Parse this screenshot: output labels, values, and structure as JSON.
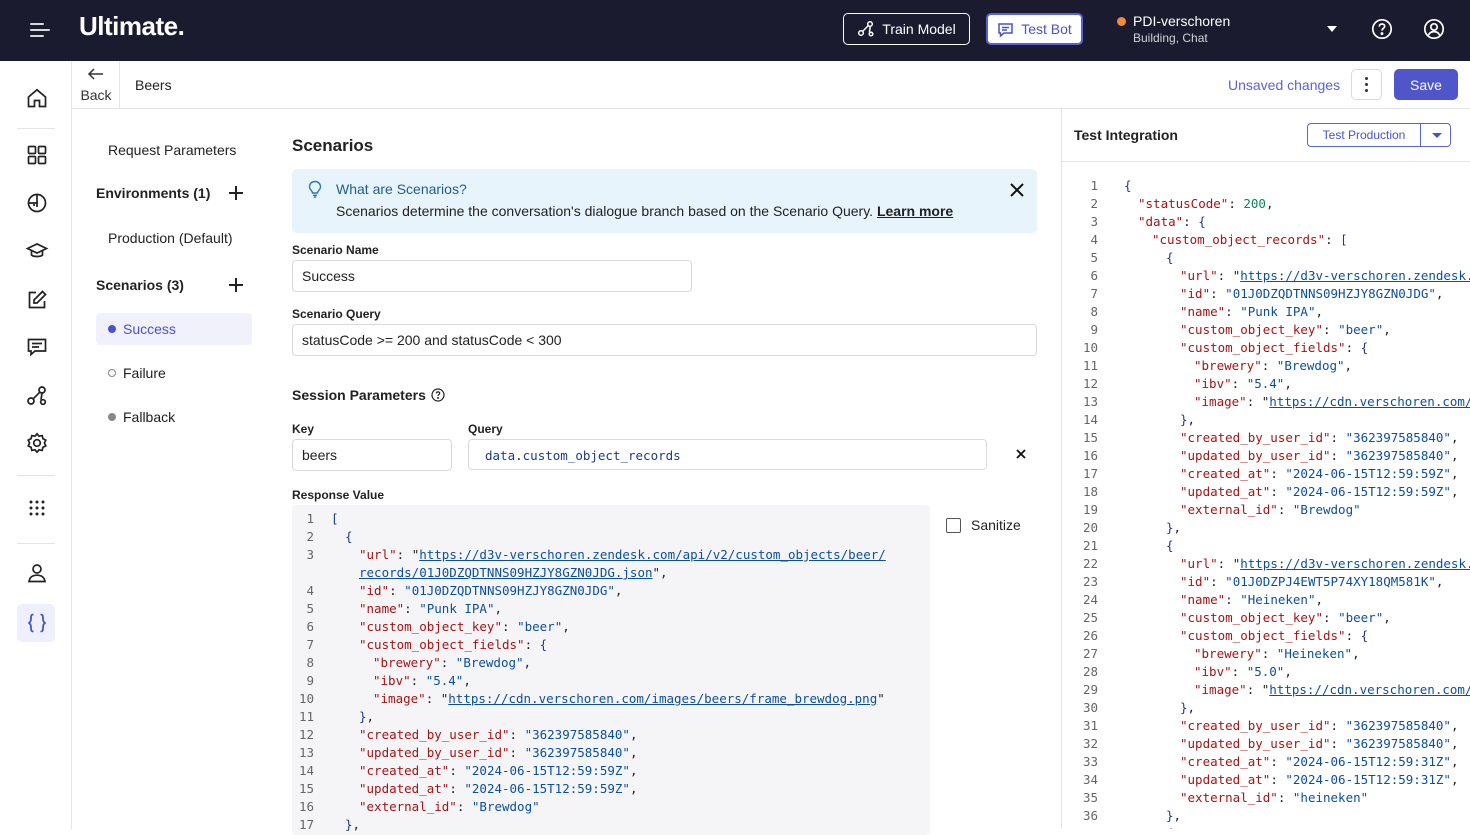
{
  "app": {
    "logo": "Ultimate.",
    "train_model_label": "Train Model",
    "test_bot_label": "Test Bot",
    "bot_name": "PDI-verschoren",
    "bot_subtitle": "Building, Chat",
    "bot_status_color": "#f08a3c",
    "accent_color": "#4f56c9"
  },
  "subheader": {
    "back_label": "Back",
    "breadcrumb": "Beers",
    "unsaved_label": "Unsaved changes",
    "save_label": "Save"
  },
  "sidebar": {
    "request_parameters": "Request Parameters",
    "environments_header": "Environments (1)",
    "environment_item": "Production (Default)",
    "scenarios_header": "Scenarios (3)",
    "scenarios": [
      {
        "label": "Success",
        "state": "active"
      },
      {
        "label": "Failure",
        "state": "empty"
      },
      {
        "label": "Fallback",
        "state": "filled"
      }
    ]
  },
  "main": {
    "title": "Scenarios",
    "info_title": "What are Scenarios?",
    "info_text": "Scenarios determine the conversation's dialogue branch based on the Scenario Query.",
    "info_link": "Learn more",
    "scenario_name_label": "Scenario Name",
    "scenario_name_value": "Success",
    "scenario_query_label": "Scenario Query",
    "scenario_query_value": "statusCode >= 200 and statusCode < 300",
    "session_parameters_label": "Session Parameters",
    "key_label": "Key",
    "key_value": "beers",
    "query_label": "Query",
    "query_prefix": "data",
    "query_dot": ".",
    "query_suffix": "custom_object_records",
    "response_value_label": "Response Value",
    "sanitize_label": "Sanitize",
    "sanitize_checked": false
  },
  "response_lines": [
    {
      "n": "1",
      "indent": 0,
      "parts": [
        [
          "b",
          "["
        ]
      ]
    },
    {
      "n": "2",
      "indent": 1,
      "parts": [
        [
          "b",
          "{"
        ]
      ]
    },
    {
      "n": "3",
      "indent": 2,
      "parts": [
        [
          "k",
          "\"url\""
        ],
        [
          "p",
          ": \""
        ],
        [
          "l",
          "https://d3v-verschoren.zendesk.com/api/v2/custom_objects/beer/"
        ]
      ]
    },
    {
      "n": "",
      "indent": 2,
      "parts": [
        [
          "l",
          "records/01J0DZQDTNNS09HZJY8GZN0JDG.json"
        ],
        [
          "p",
          "\","
        ]
      ]
    },
    {
      "n": "4",
      "indent": 2,
      "parts": [
        [
          "k",
          "\"id\""
        ],
        [
          "p",
          ": "
        ],
        [
          "v",
          "\"01J0DZQDTNNS09HZJY8GZN0JDG\""
        ],
        [
          "p",
          ","
        ]
      ]
    },
    {
      "n": "5",
      "indent": 2,
      "parts": [
        [
          "k",
          "\"name\""
        ],
        [
          "p",
          ": "
        ],
        [
          "v",
          "\"Punk IPA\""
        ],
        [
          "p",
          ","
        ]
      ]
    },
    {
      "n": "6",
      "indent": 2,
      "parts": [
        [
          "k",
          "\"custom_object_key\""
        ],
        [
          "p",
          ": "
        ],
        [
          "v",
          "\"beer\""
        ],
        [
          "p",
          ","
        ]
      ]
    },
    {
      "n": "7",
      "indent": 2,
      "parts": [
        [
          "k",
          "\"custom_object_fields\""
        ],
        [
          "p",
          ": "
        ],
        [
          "b",
          "{"
        ]
      ]
    },
    {
      "n": "8",
      "indent": 3,
      "parts": [
        [
          "k",
          "\"brewery\""
        ],
        [
          "p",
          ": "
        ],
        [
          "v",
          "\"Brewdog\""
        ],
        [
          "p",
          ","
        ]
      ]
    },
    {
      "n": "9",
      "indent": 3,
      "parts": [
        [
          "k",
          "\"ibv\""
        ],
        [
          "p",
          ": "
        ],
        [
          "v",
          "\"5.4\""
        ],
        [
          "p",
          ","
        ]
      ]
    },
    {
      "n": "10",
      "indent": 3,
      "parts": [
        [
          "k",
          "\"image\""
        ],
        [
          "p",
          ": \""
        ],
        [
          "l",
          "https://cdn.verschoren.com/images/beers/frame_brewdog.png"
        ],
        [
          "p",
          "\""
        ]
      ]
    },
    {
      "n": "11",
      "indent": 2,
      "parts": [
        [
          "b",
          "}"
        ],
        [
          "p",
          ","
        ]
      ]
    },
    {
      "n": "12",
      "indent": 2,
      "parts": [
        [
          "k",
          "\"created_by_user_id\""
        ],
        [
          "p",
          ": "
        ],
        [
          "v",
          "\"362397585840\""
        ],
        [
          "p",
          ","
        ]
      ]
    },
    {
      "n": "13",
      "indent": 2,
      "parts": [
        [
          "k",
          "\"updated_by_user_id\""
        ],
        [
          "p",
          ": "
        ],
        [
          "v",
          "\"362397585840\""
        ],
        [
          "p",
          ","
        ]
      ]
    },
    {
      "n": "14",
      "indent": 2,
      "parts": [
        [
          "k",
          "\"created_at\""
        ],
        [
          "p",
          ": "
        ],
        [
          "v",
          "\"2024-06-15T12:59:59Z\""
        ],
        [
          "p",
          ","
        ]
      ]
    },
    {
      "n": "15",
      "indent": 2,
      "parts": [
        [
          "k",
          "\"updated_at\""
        ],
        [
          "p",
          ": "
        ],
        [
          "v",
          "\"2024-06-15T12:59:59Z\""
        ],
        [
          "p",
          ","
        ]
      ]
    },
    {
      "n": "16",
      "indent": 2,
      "parts": [
        [
          "k",
          "\"external_id\""
        ],
        [
          "p",
          ": "
        ],
        [
          "v",
          "\"Brewdog\""
        ]
      ]
    },
    {
      "n": "17",
      "indent": 1,
      "parts": [
        [
          "b",
          "}"
        ],
        [
          "p",
          ","
        ]
      ]
    }
  ],
  "test_panel": {
    "title": "Test Integration",
    "env_button": "Test Production"
  },
  "test_lines": [
    {
      "n": "1",
      "indent": 0,
      "parts": [
        [
          "b",
          "{"
        ]
      ]
    },
    {
      "n": "2",
      "indent": 1,
      "parts": [
        [
          "k",
          "\"statusCode\""
        ],
        [
          "p",
          ": "
        ],
        [
          "n",
          "200"
        ],
        [
          "p",
          ","
        ]
      ]
    },
    {
      "n": "3",
      "indent": 1,
      "parts": [
        [
          "k",
          "\"data\""
        ],
        [
          "p",
          ": "
        ],
        [
          "b",
          "{"
        ]
      ]
    },
    {
      "n": "4",
      "indent": 2,
      "parts": [
        [
          "k",
          "\"custom_object_records\""
        ],
        [
          "p",
          ": "
        ],
        [
          "b",
          "["
        ]
      ]
    },
    {
      "n": "5",
      "indent": 3,
      "parts": [
        [
          "b",
          "{"
        ]
      ]
    },
    {
      "n": "6",
      "indent": 4,
      "parts": [
        [
          "k",
          "\"url\""
        ],
        [
          "p",
          ": \""
        ],
        [
          "l",
          "https://d3v-verschoren.zendesk.c"
        ]
      ]
    },
    {
      "n": "7",
      "indent": 4,
      "parts": [
        [
          "k",
          "\"id\""
        ],
        [
          "p",
          ": "
        ],
        [
          "v",
          "\"01J0DZQDTNNS09HZJY8GZN0JDG\""
        ],
        [
          "p",
          ","
        ]
      ]
    },
    {
      "n": "8",
      "indent": 4,
      "parts": [
        [
          "k",
          "\"name\""
        ],
        [
          "p",
          ": "
        ],
        [
          "v",
          "\"Punk IPA\""
        ],
        [
          "p",
          ","
        ]
      ]
    },
    {
      "n": "9",
      "indent": 4,
      "parts": [
        [
          "k",
          "\"custom_object_key\""
        ],
        [
          "p",
          ": "
        ],
        [
          "v",
          "\"beer\""
        ],
        [
          "p",
          ","
        ]
      ]
    },
    {
      "n": "10",
      "indent": 4,
      "parts": [
        [
          "k",
          "\"custom_object_fields\""
        ],
        [
          "p",
          ": "
        ],
        [
          "b",
          "{"
        ]
      ]
    },
    {
      "n": "11",
      "indent": 5,
      "parts": [
        [
          "k",
          "\"brewery\""
        ],
        [
          "p",
          ": "
        ],
        [
          "v",
          "\"Brewdog\""
        ],
        [
          "p",
          ","
        ]
      ]
    },
    {
      "n": "12",
      "indent": 5,
      "parts": [
        [
          "k",
          "\"ibv\""
        ],
        [
          "p",
          ": "
        ],
        [
          "v",
          "\"5.4\""
        ],
        [
          "p",
          ","
        ]
      ]
    },
    {
      "n": "13",
      "indent": 5,
      "parts": [
        [
          "k",
          "\"image\""
        ],
        [
          "p",
          ": \""
        ],
        [
          "l",
          "https://cdn.verschoren.com/i"
        ]
      ]
    },
    {
      "n": "14",
      "indent": 4,
      "parts": [
        [
          "b",
          "}"
        ],
        [
          "p",
          ","
        ]
      ]
    },
    {
      "n": "15",
      "indent": 4,
      "parts": [
        [
          "k",
          "\"created_by_user_id\""
        ],
        [
          "p",
          ": "
        ],
        [
          "v",
          "\"362397585840\""
        ],
        [
          "p",
          ","
        ]
      ]
    },
    {
      "n": "16",
      "indent": 4,
      "parts": [
        [
          "k",
          "\"updated_by_user_id\""
        ],
        [
          "p",
          ": "
        ],
        [
          "v",
          "\"362397585840\""
        ],
        [
          "p",
          ","
        ]
      ]
    },
    {
      "n": "17",
      "indent": 4,
      "parts": [
        [
          "k",
          "\"created_at\""
        ],
        [
          "p",
          ": "
        ],
        [
          "v",
          "\"2024-06-15T12:59:59Z\""
        ],
        [
          "p",
          ","
        ]
      ]
    },
    {
      "n": "18",
      "indent": 4,
      "parts": [
        [
          "k",
          "\"updated_at\""
        ],
        [
          "p",
          ": "
        ],
        [
          "v",
          "\"2024-06-15T12:59:59Z\""
        ],
        [
          "p",
          ","
        ]
      ]
    },
    {
      "n": "19",
      "indent": 4,
      "parts": [
        [
          "k",
          "\"external_id\""
        ],
        [
          "p",
          ": "
        ],
        [
          "v",
          "\"Brewdog\""
        ]
      ]
    },
    {
      "n": "20",
      "indent": 3,
      "parts": [
        [
          "b",
          "}"
        ],
        [
          "p",
          ","
        ]
      ]
    },
    {
      "n": "21",
      "indent": 3,
      "parts": [
        [
          "b",
          "{"
        ]
      ]
    },
    {
      "n": "22",
      "indent": 4,
      "parts": [
        [
          "k",
          "\"url\""
        ],
        [
          "p",
          ": \""
        ],
        [
          "l",
          "https://d3v-verschoren.zendesk.c"
        ]
      ]
    },
    {
      "n": "23",
      "indent": 4,
      "parts": [
        [
          "k",
          "\"id\""
        ],
        [
          "p",
          ": "
        ],
        [
          "v",
          "\"01J0DZPJ4EWT5P74XY18QM581K\""
        ],
        [
          "p",
          ","
        ]
      ]
    },
    {
      "n": "24",
      "indent": 4,
      "parts": [
        [
          "k",
          "\"name\""
        ],
        [
          "p",
          ": "
        ],
        [
          "v",
          "\"Heineken\""
        ],
        [
          "p",
          ","
        ]
      ]
    },
    {
      "n": "25",
      "indent": 4,
      "parts": [
        [
          "k",
          "\"custom_object_key\""
        ],
        [
          "p",
          ": "
        ],
        [
          "v",
          "\"beer\""
        ],
        [
          "p",
          ","
        ]
      ]
    },
    {
      "n": "26",
      "indent": 4,
      "parts": [
        [
          "k",
          "\"custom_object_fields\""
        ],
        [
          "p",
          ": "
        ],
        [
          "b",
          "{"
        ]
      ]
    },
    {
      "n": "27",
      "indent": 5,
      "parts": [
        [
          "k",
          "\"brewery\""
        ],
        [
          "p",
          ": "
        ],
        [
          "v",
          "\"Heineken\""
        ],
        [
          "p",
          ","
        ]
      ]
    },
    {
      "n": "28",
      "indent": 5,
      "parts": [
        [
          "k",
          "\"ibv\""
        ],
        [
          "p",
          ": "
        ],
        [
          "v",
          "\"5.0\""
        ],
        [
          "p",
          ","
        ]
      ]
    },
    {
      "n": "29",
      "indent": 5,
      "parts": [
        [
          "k",
          "\"image\""
        ],
        [
          "p",
          ": \""
        ],
        [
          "l",
          "https://cdn.verschoren.com/i"
        ]
      ]
    },
    {
      "n": "30",
      "indent": 4,
      "parts": [
        [
          "b",
          "}"
        ],
        [
          "p",
          ","
        ]
      ]
    },
    {
      "n": "31",
      "indent": 4,
      "parts": [
        [
          "k",
          "\"created_by_user_id\""
        ],
        [
          "p",
          ": "
        ],
        [
          "v",
          "\"362397585840\""
        ],
        [
          "p",
          ","
        ]
      ]
    },
    {
      "n": "32",
      "indent": 4,
      "parts": [
        [
          "k",
          "\"updated_by_user_id\""
        ],
        [
          "p",
          ": "
        ],
        [
          "v",
          "\"362397585840\""
        ],
        [
          "p",
          ","
        ]
      ]
    },
    {
      "n": "33",
      "indent": 4,
      "parts": [
        [
          "k",
          "\"created_at\""
        ],
        [
          "p",
          ": "
        ],
        [
          "v",
          "\"2024-06-15T12:59:31Z\""
        ],
        [
          "p",
          ","
        ]
      ]
    },
    {
      "n": "34",
      "indent": 4,
      "parts": [
        [
          "k",
          "\"updated_at\""
        ],
        [
          "p",
          ": "
        ],
        [
          "v",
          "\"2024-06-15T12:59:31Z\""
        ],
        [
          "p",
          ","
        ]
      ]
    },
    {
      "n": "35",
      "indent": 4,
      "parts": [
        [
          "k",
          "\"external_id\""
        ],
        [
          "p",
          ": "
        ],
        [
          "v",
          "\"heineken\""
        ]
      ]
    },
    {
      "n": "36",
      "indent": 3,
      "parts": [
        [
          "b",
          "}"
        ],
        [
          "p",
          ","
        ]
      ]
    },
    {
      "n": "37",
      "indent": 3,
      "parts": [
        [
          "b",
          "{"
        ]
      ]
    }
  ]
}
